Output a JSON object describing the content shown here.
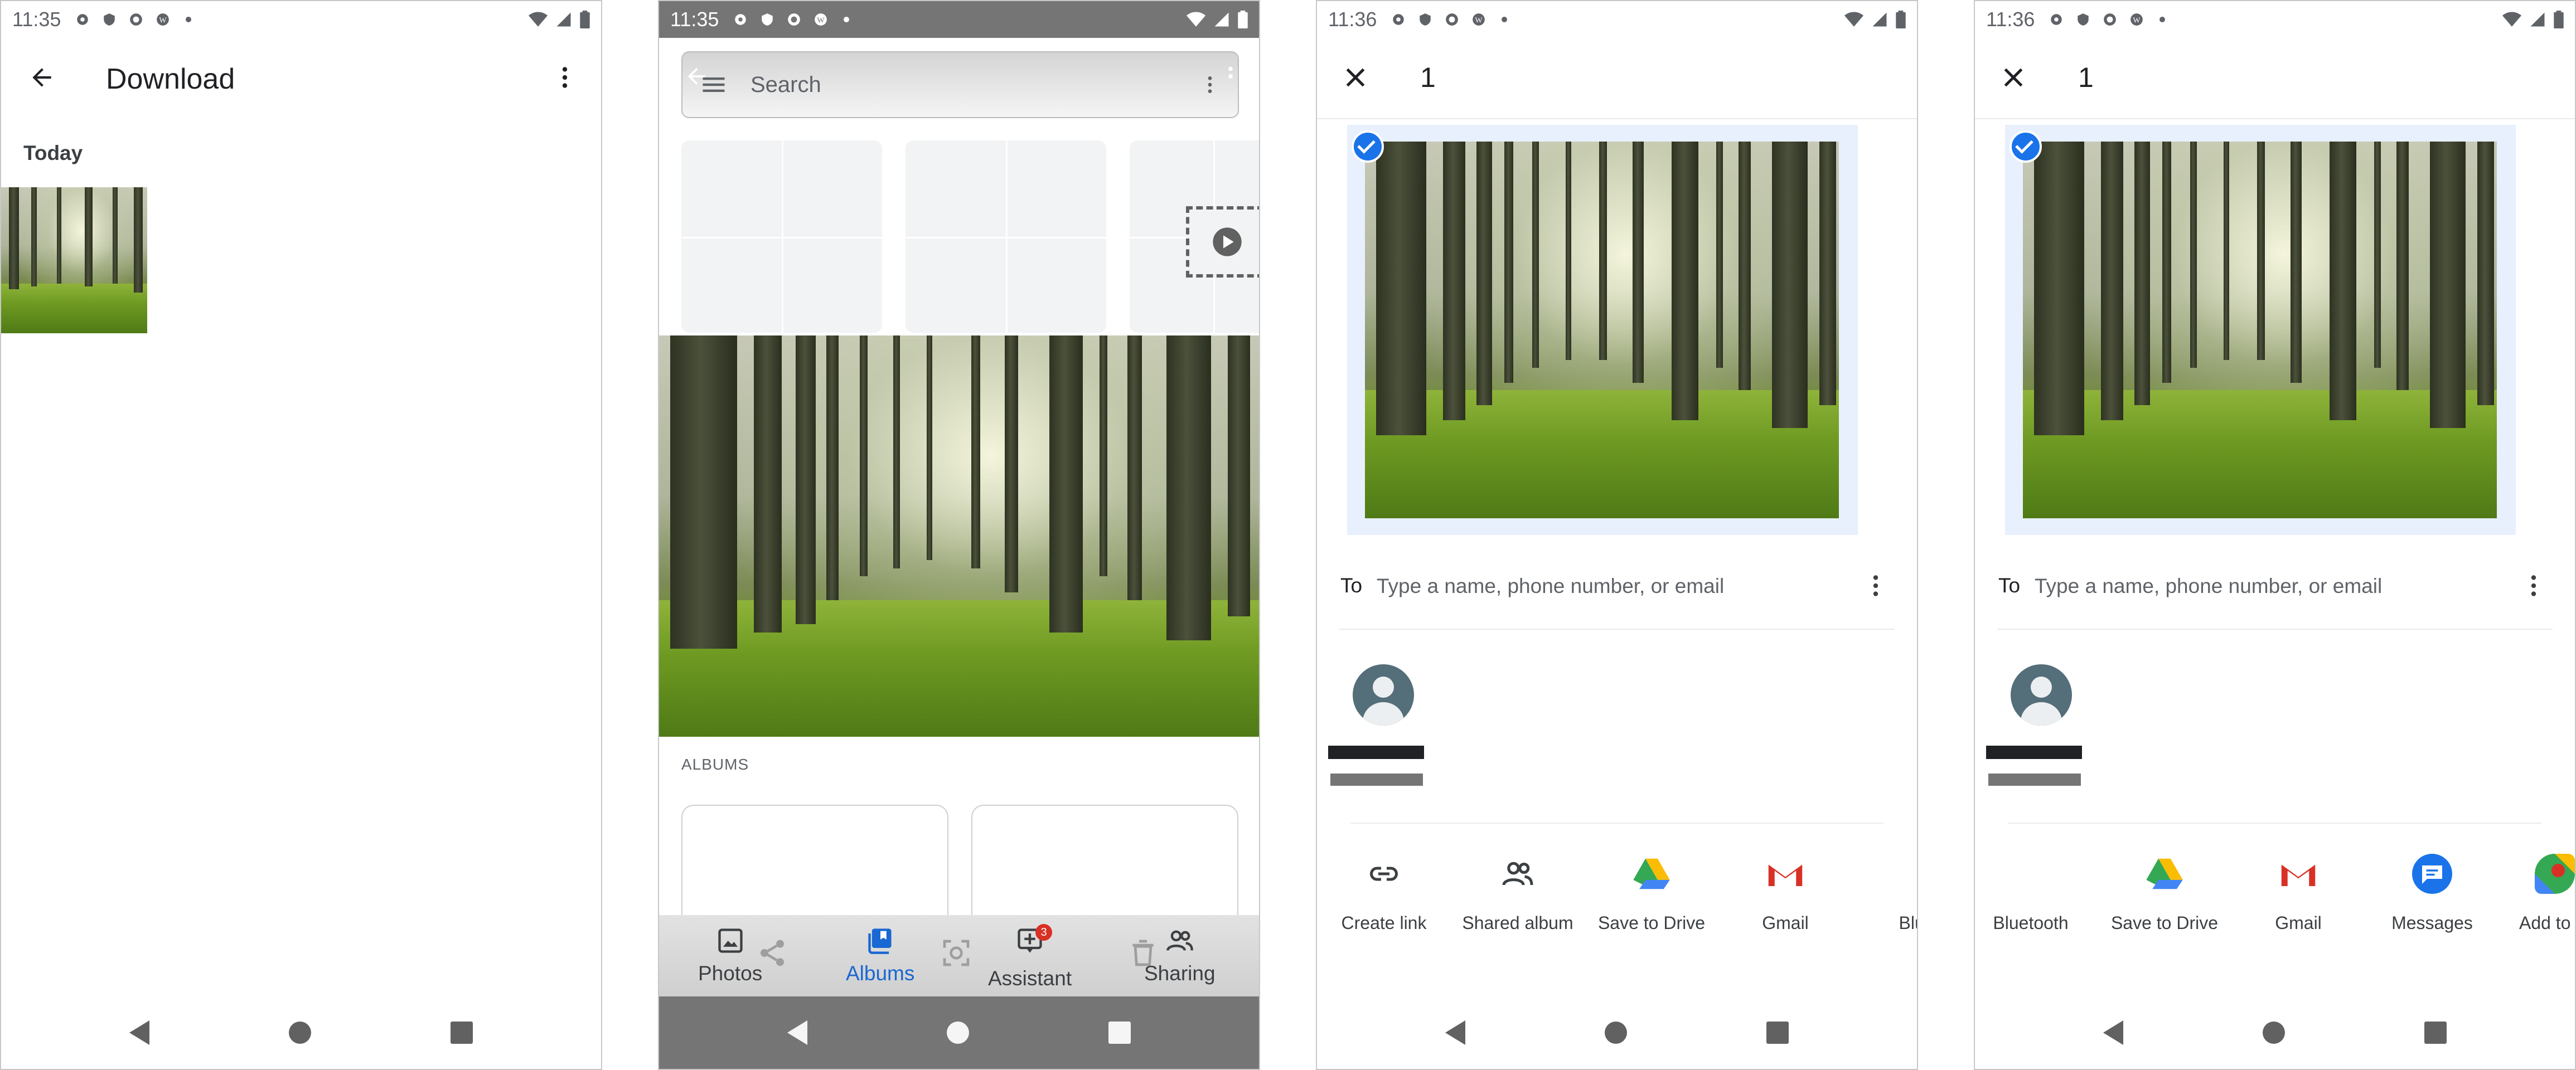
{
  "status_times": [
    "11:35",
    "11:35",
    "11:36",
    "11:36"
  ],
  "panel1": {
    "title": "Download",
    "section_label": "Today"
  },
  "panel2": {
    "search_placeholder": "Search",
    "albums_label": "ALBUMS",
    "tabs": [
      {
        "label": "Photos",
        "icon": "photo-icon",
        "active": false
      },
      {
        "label": "Albums",
        "icon": "albums-icon",
        "active": true
      },
      {
        "label": "Assistant",
        "icon": "assistant-icon",
        "active": false,
        "badge": "3"
      },
      {
        "label": "Sharing",
        "icon": "sharing-icon",
        "active": false
      }
    ]
  },
  "share_sheet": {
    "selected_count": "1",
    "to_label": "To",
    "to_placeholder": "Type a name, phone number, or email"
  },
  "panel3_apps": [
    "Create link",
    "Shared album",
    "Save to Drive",
    "Gmail",
    "Bluet"
  ],
  "panel4_apps": [
    "Bluetooth",
    "Save to Drive",
    "Gmail",
    "Messages",
    "Add to M"
  ],
  "colors": {
    "accent_blue": "#1a73e8",
    "selection_bg": "#e8f0fe",
    "status_dark": "#757575",
    "gmail_red": "#d93025",
    "drive_yellow": "#fbbc04",
    "drive_green": "#34a853",
    "drive_blue": "#4285f4"
  }
}
